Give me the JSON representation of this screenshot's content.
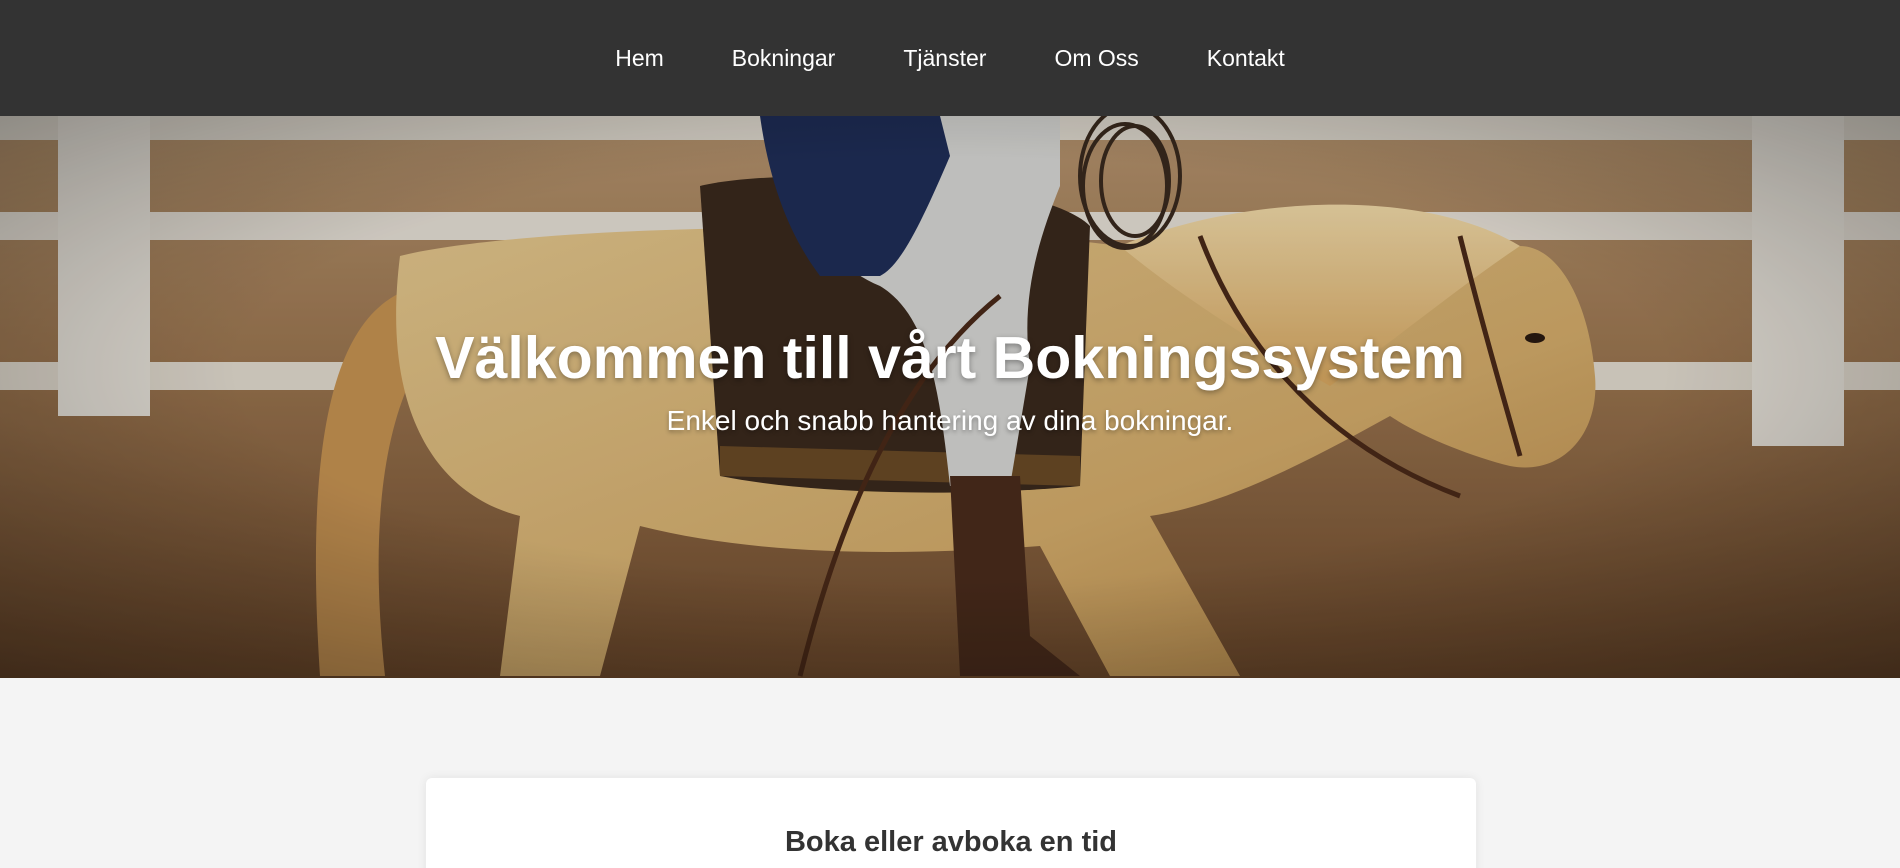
{
  "nav": {
    "items": [
      {
        "label": "Hem"
      },
      {
        "label": "Bokningar"
      },
      {
        "label": "Tjänster"
      },
      {
        "label": "Om Oss"
      },
      {
        "label": "Kontakt"
      }
    ]
  },
  "hero": {
    "title": "Välkommen till vårt Bokningssystem",
    "subtitle": "Enkel och snabb hantering av dina bokningar.",
    "image": "horse-rider-arena-photo"
  },
  "booking_card": {
    "title": "Boka eller avboka en tid"
  },
  "colors": {
    "nav_bg": "#333333",
    "page_bg": "#f4f4f4",
    "card_bg": "#ffffff",
    "text": "#333333"
  }
}
